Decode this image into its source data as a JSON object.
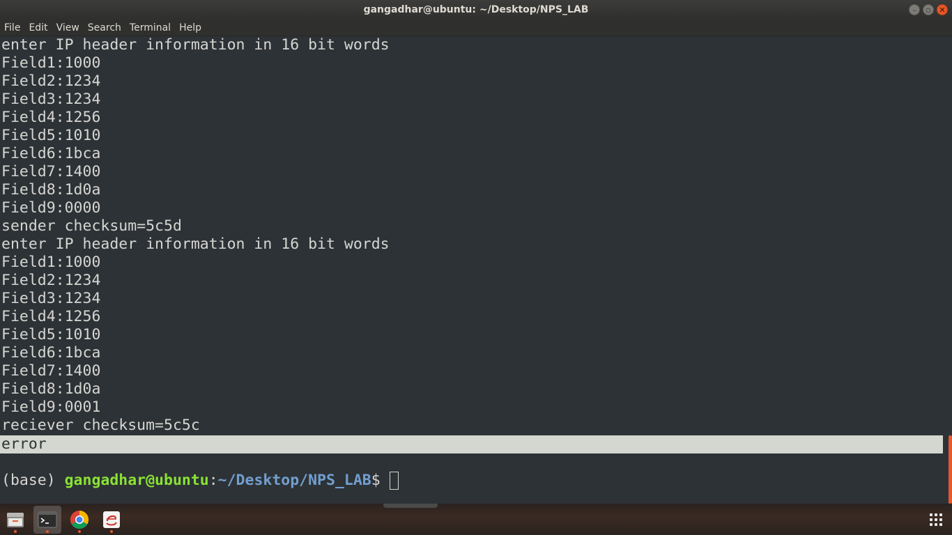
{
  "window": {
    "title": "gangadhar@ubuntu: ~/Desktop/NPS_LAB"
  },
  "menu": [
    "File",
    "Edit",
    "View",
    "Search",
    "Terminal",
    "Help"
  ],
  "terminal": {
    "lines": [
      "enter IP header information in 16 bit words",
      "Field1:1000",
      "Field2:1234",
      "Field3:1234",
      "Field4:1256",
      "Field5:1010",
      "Field6:1bca",
      "Field7:1400",
      "Field8:1d0a",
      "Field9:0000",
      "sender checksum=5c5d",
      "enter IP header information in 16 bit words",
      "Field1:1000",
      "Field2:1234",
      "Field3:1234",
      "Field4:1256",
      "Field5:1010",
      "Field6:1bca",
      "Field7:1400",
      "Field8:1d0a",
      "Field9:0001",
      "reciever checksum=5c5c"
    ],
    "highlighted_line": "error",
    "prompt": {
      "env": "(base) ",
      "user_host": "gangadhar@ubuntu",
      "colon": ":",
      "path": "~/Desktop/NPS_LAB",
      "dollar": "$ "
    }
  },
  "dock": {
    "apps": [
      {
        "name": "file-manager-icon",
        "active": false
      },
      {
        "name": "terminal-icon",
        "active": true
      },
      {
        "name": "chrome-icon",
        "active": false
      },
      {
        "name": "eclipse-icon",
        "active": false
      }
    ]
  },
  "colors": {
    "terminal_bg": "#2d3236",
    "prompt_user": "#8ae234",
    "prompt_path": "#729fcf",
    "accent": "#e8572a"
  }
}
